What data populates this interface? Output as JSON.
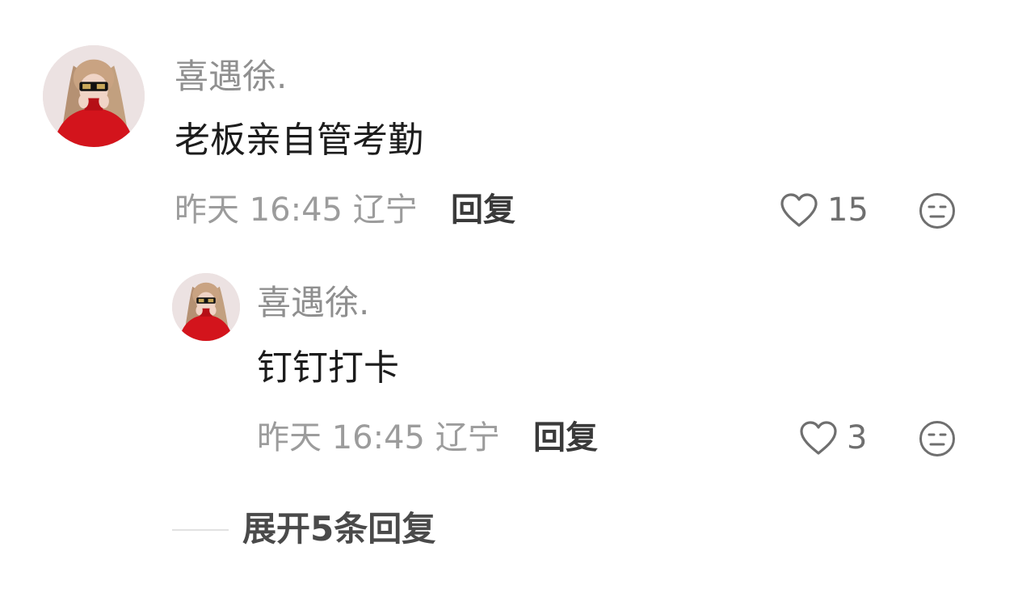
{
  "comment": {
    "username": "喜遇徐.",
    "text": "老板亲自管考勤",
    "time": "昨天 16:45",
    "location": "辽宁",
    "reply_label": "回复",
    "like_count": "15",
    "icons": {
      "like": "heart-outline-icon",
      "react": "neutral-face-icon"
    },
    "reply": {
      "username": "喜遇徐.",
      "text": "钉钉打卡",
      "time": "昨天 16:45",
      "location": "辽宁",
      "reply_label": "回复",
      "like_count": "3"
    }
  },
  "expand_replies_label": "展开5条回复",
  "colors": {
    "username": "#8f8f8f",
    "text": "#1c1c1c",
    "meta": "#9c9c9c",
    "icon": "#6f6f6f",
    "avatar_sweater": "#d3141c"
  }
}
